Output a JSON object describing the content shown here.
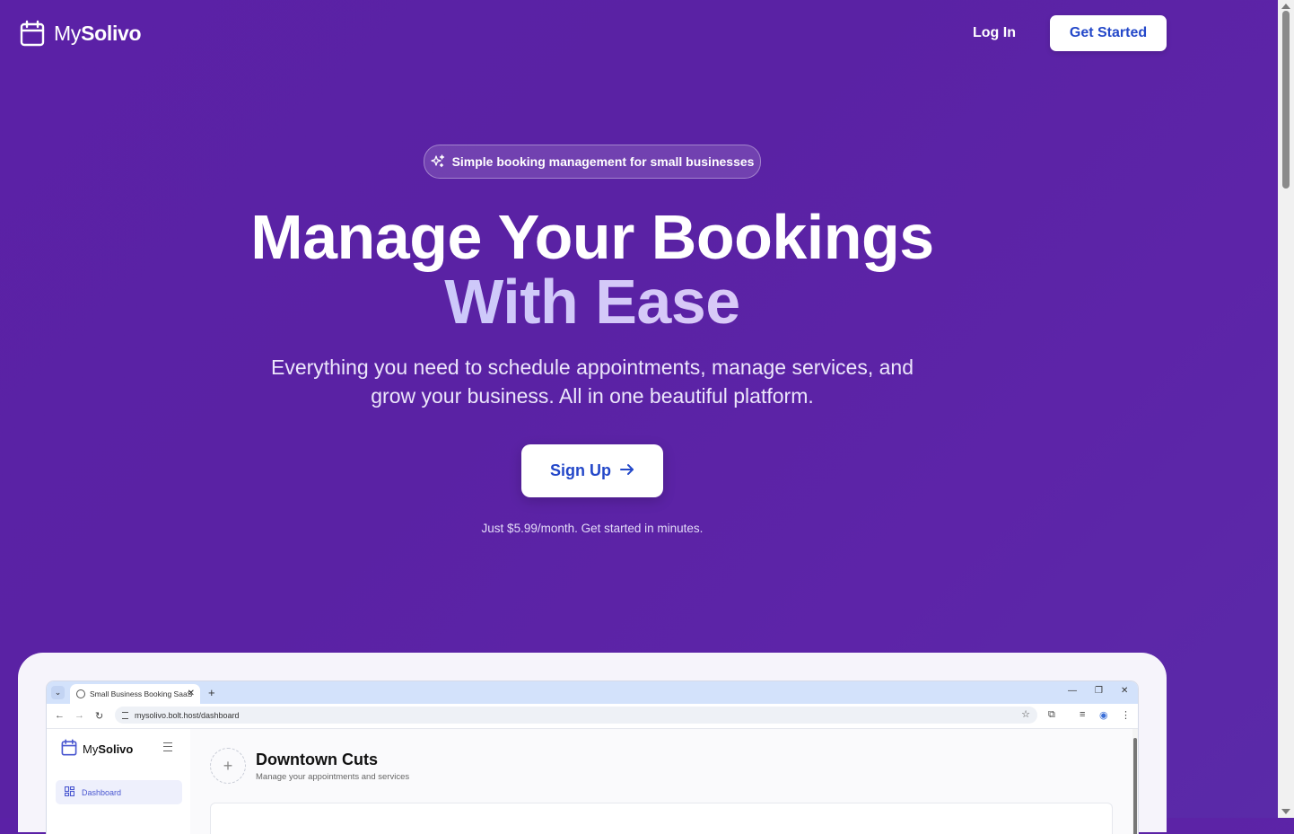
{
  "nav": {
    "logo_my": "My",
    "logo_brand": "Solivo",
    "login_label": "Log In",
    "get_started_label": "Get Started"
  },
  "hero": {
    "pill_text": "Simple booking management for small businesses",
    "title_line1": "Manage Your Bookings",
    "title_line2": "With Ease",
    "subtitle_line1": "Everything you need to schedule appointments, manage services, and",
    "subtitle_line2": "grow your business. All in one beautiful platform.",
    "cta_label": "Sign Up",
    "price_note": "Just $5.99/month. Get started in minutes."
  },
  "preview": {
    "tab_title": "Small Business Booking SaaS",
    "url": "mysolivo.bolt.host/dashboard",
    "app_logo_my": "My",
    "app_logo_brand": "Solivo",
    "sidebar_items": [
      {
        "label": "Dashboard",
        "active": true
      }
    ],
    "business_name": "Downtown Cuts",
    "business_subtitle": "Manage your appointments and services"
  },
  "colors": {
    "background": "#5b21a6",
    "cta_text": "#2448c9",
    "accent_gradient_start": "#b9c8ff"
  }
}
